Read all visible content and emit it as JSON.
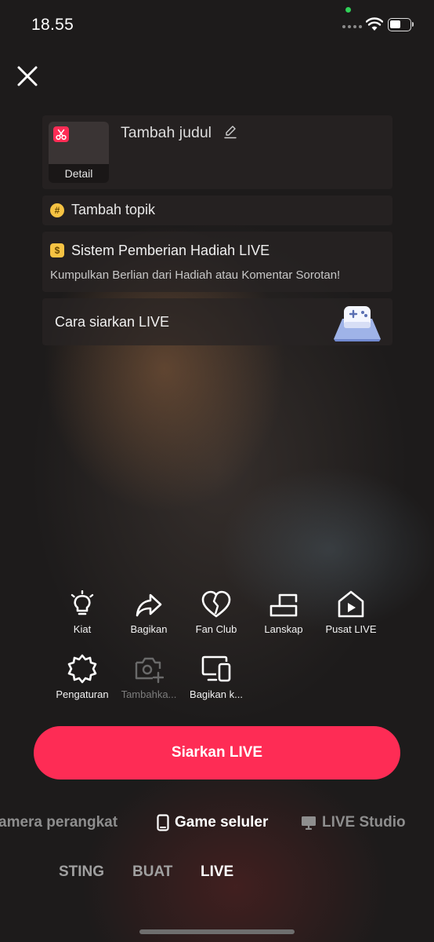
{
  "status_bar": {
    "time": "18.55"
  },
  "title_card": {
    "thumb_label": "Detail",
    "title_placeholder": "Tambah judul"
  },
  "topic": {
    "label": "Tambah topik"
  },
  "gift": {
    "title": "Sistem Pemberian Hadiah LIVE",
    "subtitle": "Kumpulkan Berlian dari Hadiah atau Komentar Sorotan!"
  },
  "howto": {
    "label": "Cara siarkan LIVE"
  },
  "tools": [
    {
      "label": "Kiat",
      "icon": "lightbulb-icon"
    },
    {
      "label": "Bagikan",
      "icon": "share-icon"
    },
    {
      "label": "Fan Club",
      "icon": "heart-icon"
    },
    {
      "label": "Lanskap",
      "icon": "landscape-icon"
    },
    {
      "label": "Pusat LIVE",
      "icon": "live-center-icon"
    },
    {
      "label": "Pengaturan",
      "icon": "settings-gear-icon"
    },
    {
      "label": "Tambahka...",
      "icon": "add-camera-icon"
    },
    {
      "label": "Bagikan k...",
      "icon": "share-screen-icon"
    }
  ],
  "go_live_button": "Siarkan LIVE",
  "modes": [
    {
      "label": "amera perangkat",
      "active": false
    },
    {
      "label": "Game seluler",
      "active": true,
      "icon": "phone-icon"
    },
    {
      "label": "LIVE Studio",
      "active": false,
      "icon": "monitor-icon"
    }
  ],
  "bottom_tabs": [
    {
      "label": "STING",
      "active": false
    },
    {
      "label": "BUAT",
      "active": false
    },
    {
      "label": "LIVE",
      "active": true
    }
  ],
  "colors": {
    "accent": "#fe2c55",
    "panel": "#282424"
  }
}
